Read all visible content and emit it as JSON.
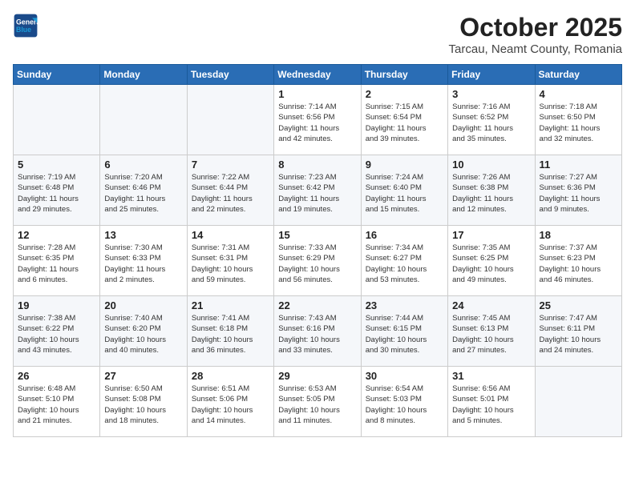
{
  "header": {
    "logo_line1": "General",
    "logo_line2": "Blue",
    "month": "October 2025",
    "location": "Tarcau, Neamt County, Romania"
  },
  "weekdays": [
    "Sunday",
    "Monday",
    "Tuesday",
    "Wednesday",
    "Thursday",
    "Friday",
    "Saturday"
  ],
  "weeks": [
    [
      {
        "day": "",
        "info": ""
      },
      {
        "day": "",
        "info": ""
      },
      {
        "day": "",
        "info": ""
      },
      {
        "day": "1",
        "info": "Sunrise: 7:14 AM\nSunset: 6:56 PM\nDaylight: 11 hours\nand 42 minutes."
      },
      {
        "day": "2",
        "info": "Sunrise: 7:15 AM\nSunset: 6:54 PM\nDaylight: 11 hours\nand 39 minutes."
      },
      {
        "day": "3",
        "info": "Sunrise: 7:16 AM\nSunset: 6:52 PM\nDaylight: 11 hours\nand 35 minutes."
      },
      {
        "day": "4",
        "info": "Sunrise: 7:18 AM\nSunset: 6:50 PM\nDaylight: 11 hours\nand 32 minutes."
      }
    ],
    [
      {
        "day": "5",
        "info": "Sunrise: 7:19 AM\nSunset: 6:48 PM\nDaylight: 11 hours\nand 29 minutes."
      },
      {
        "day": "6",
        "info": "Sunrise: 7:20 AM\nSunset: 6:46 PM\nDaylight: 11 hours\nand 25 minutes."
      },
      {
        "day": "7",
        "info": "Sunrise: 7:22 AM\nSunset: 6:44 PM\nDaylight: 11 hours\nand 22 minutes."
      },
      {
        "day": "8",
        "info": "Sunrise: 7:23 AM\nSunset: 6:42 PM\nDaylight: 11 hours\nand 19 minutes."
      },
      {
        "day": "9",
        "info": "Sunrise: 7:24 AM\nSunset: 6:40 PM\nDaylight: 11 hours\nand 15 minutes."
      },
      {
        "day": "10",
        "info": "Sunrise: 7:26 AM\nSunset: 6:38 PM\nDaylight: 11 hours\nand 12 minutes."
      },
      {
        "day": "11",
        "info": "Sunrise: 7:27 AM\nSunset: 6:36 PM\nDaylight: 11 hours\nand 9 minutes."
      }
    ],
    [
      {
        "day": "12",
        "info": "Sunrise: 7:28 AM\nSunset: 6:35 PM\nDaylight: 11 hours\nand 6 minutes."
      },
      {
        "day": "13",
        "info": "Sunrise: 7:30 AM\nSunset: 6:33 PM\nDaylight: 11 hours\nand 2 minutes."
      },
      {
        "day": "14",
        "info": "Sunrise: 7:31 AM\nSunset: 6:31 PM\nDaylight: 10 hours\nand 59 minutes."
      },
      {
        "day": "15",
        "info": "Sunrise: 7:33 AM\nSunset: 6:29 PM\nDaylight: 10 hours\nand 56 minutes."
      },
      {
        "day": "16",
        "info": "Sunrise: 7:34 AM\nSunset: 6:27 PM\nDaylight: 10 hours\nand 53 minutes."
      },
      {
        "day": "17",
        "info": "Sunrise: 7:35 AM\nSunset: 6:25 PM\nDaylight: 10 hours\nand 49 minutes."
      },
      {
        "day": "18",
        "info": "Sunrise: 7:37 AM\nSunset: 6:23 PM\nDaylight: 10 hours\nand 46 minutes."
      }
    ],
    [
      {
        "day": "19",
        "info": "Sunrise: 7:38 AM\nSunset: 6:22 PM\nDaylight: 10 hours\nand 43 minutes."
      },
      {
        "day": "20",
        "info": "Sunrise: 7:40 AM\nSunset: 6:20 PM\nDaylight: 10 hours\nand 40 minutes."
      },
      {
        "day": "21",
        "info": "Sunrise: 7:41 AM\nSunset: 6:18 PM\nDaylight: 10 hours\nand 36 minutes."
      },
      {
        "day": "22",
        "info": "Sunrise: 7:43 AM\nSunset: 6:16 PM\nDaylight: 10 hours\nand 33 minutes."
      },
      {
        "day": "23",
        "info": "Sunrise: 7:44 AM\nSunset: 6:15 PM\nDaylight: 10 hours\nand 30 minutes."
      },
      {
        "day": "24",
        "info": "Sunrise: 7:45 AM\nSunset: 6:13 PM\nDaylight: 10 hours\nand 27 minutes."
      },
      {
        "day": "25",
        "info": "Sunrise: 7:47 AM\nSunset: 6:11 PM\nDaylight: 10 hours\nand 24 minutes."
      }
    ],
    [
      {
        "day": "26",
        "info": "Sunrise: 6:48 AM\nSunset: 5:10 PM\nDaylight: 10 hours\nand 21 minutes."
      },
      {
        "day": "27",
        "info": "Sunrise: 6:50 AM\nSunset: 5:08 PM\nDaylight: 10 hours\nand 18 minutes."
      },
      {
        "day": "28",
        "info": "Sunrise: 6:51 AM\nSunset: 5:06 PM\nDaylight: 10 hours\nand 14 minutes."
      },
      {
        "day": "29",
        "info": "Sunrise: 6:53 AM\nSunset: 5:05 PM\nDaylight: 10 hours\nand 11 minutes."
      },
      {
        "day": "30",
        "info": "Sunrise: 6:54 AM\nSunset: 5:03 PM\nDaylight: 10 hours\nand 8 minutes."
      },
      {
        "day": "31",
        "info": "Sunrise: 6:56 AM\nSunset: 5:01 PM\nDaylight: 10 hours\nand 5 minutes."
      },
      {
        "day": "",
        "info": ""
      }
    ]
  ]
}
